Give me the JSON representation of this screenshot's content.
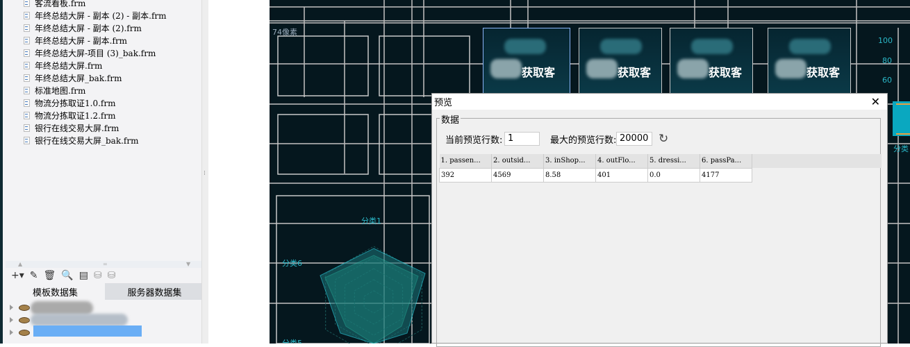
{
  "file_list": [
    "客流看板.frm",
    "年终总结大屏 - 副本 (2) - 副本.frm",
    "年终总结大屏 - 副本 (2).frm",
    "年终总结大屏 - 副本.frm",
    "年终总结大屏-项目 (3)_bak.frm",
    "年终总结大屏.frm",
    "年终总结大屏_bak.frm",
    "标准地图.frm",
    "物流分拣取证1.0.frm",
    "物流分拣取证1.2.frm",
    "银行在线交易大屏.frm",
    "银行在线交易大屏_bak.frm"
  ],
  "dataset_tabs": {
    "template": "模板数据集",
    "server": "服务器数据集"
  },
  "canvas": {
    "pixel_label": "74像素",
    "card_text": "获取客",
    "radar_labels": [
      "分类1",
      "分类6",
      "分类5"
    ],
    "axis_ticks": [
      "100",
      "80",
      "60"
    ],
    "bar_label": "分类"
  },
  "dialog": {
    "title": "预览",
    "close": "✕",
    "group": "数据",
    "current_rows_label": "当前预览行数:",
    "current_rows": "1",
    "max_rows_label": "最大的预览行数:",
    "max_rows": "20000",
    "columns": [
      "1. passen...",
      "2. outsid...",
      "3. inShop...",
      "4. outFlo...",
      "5. dressi...",
      "6. passPa..."
    ],
    "rows": [
      [
        "392",
        "4569",
        "8.58",
        "401",
        "0.0",
        "4177"
      ]
    ]
  }
}
